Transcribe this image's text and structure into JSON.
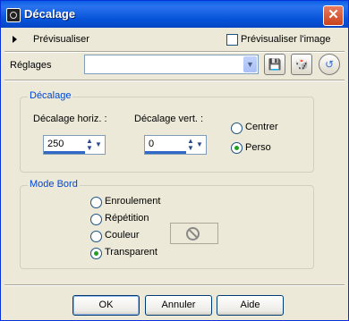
{
  "window": {
    "title": "Décalage",
    "close_glyph": "✕"
  },
  "preview": {
    "label": "Prévisualiser",
    "checkbox_label": "Prévisualiser l'image",
    "checked": false
  },
  "presets": {
    "label": "Réglages",
    "value": "",
    "buttons": [
      "save-preset-icon",
      "dice-icon",
      "reset-icon"
    ]
  },
  "offset": {
    "legend": "Décalage",
    "horiz_label": "Décalage horiz. :",
    "horiz_value": "250",
    "vert_label": "Décalage vert. :",
    "vert_value": "0",
    "options": [
      {
        "label": "Centrer",
        "selected": false
      },
      {
        "label": "Perso",
        "selected": true
      }
    ]
  },
  "edge_mode": {
    "legend": "Mode Bord",
    "options": [
      {
        "label": "Enroulement",
        "selected": false
      },
      {
        "label": "Répétition",
        "selected": false
      },
      {
        "label": "Couleur",
        "selected": false
      },
      {
        "label": "Transparent",
        "selected": true
      }
    ]
  },
  "buttons": {
    "ok": "OK",
    "cancel": "Annuler",
    "help": "Aide"
  },
  "colors": {
    "title_bar": "#0A5FE4",
    "accent": "#0046D5",
    "face": "#ECE9D8"
  }
}
